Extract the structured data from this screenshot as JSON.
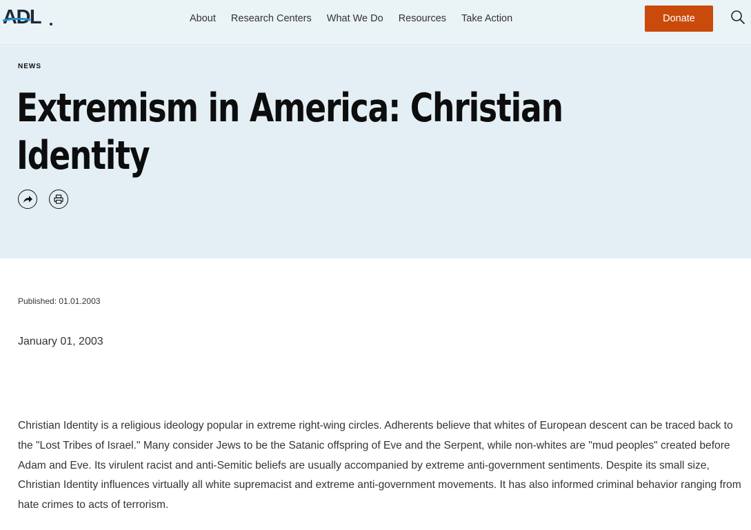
{
  "header": {
    "logo_text": "ADL",
    "nav": [
      "About",
      "Research Centers",
      "What We Do",
      "Resources",
      "Take Action"
    ],
    "donate_label": "Donate",
    "search_icon": "search-icon"
  },
  "hero": {
    "eyebrow": "NEWS",
    "title_line1": "Extremism in America: Christian",
    "title_line2": "Identity",
    "share_icon": "share-icon",
    "print_icon": "print-icon"
  },
  "article": {
    "published": "Published: 01.01.2003",
    "date": "January 01, 2003",
    "body": "Christian Identity is a religious ideology popular in extreme right-wing circles. Adherents believe that whites of European descent can be traced back to the \"Lost Tribes of Israel.\" Many consider Jews to be the Satanic offspring of Eve and the Serpent, while non-whites are \"mud peoples\" created before Adam and Eve. Its virulent racist and anti-Semitic beliefs are usually accompanied by extreme anti-government sentiments. Despite its small size, Christian Identity influences virtually all white supremacist and extreme anti-government movements. It has also informed criminal behavior ranging from hate crimes to acts of terrorism."
  },
  "colors": {
    "header_bg": "#eaf3f6",
    "hero_bg": "#e3eff4",
    "donate_bg": "#c94a0b",
    "logo_accent": "#2a8fc6"
  }
}
